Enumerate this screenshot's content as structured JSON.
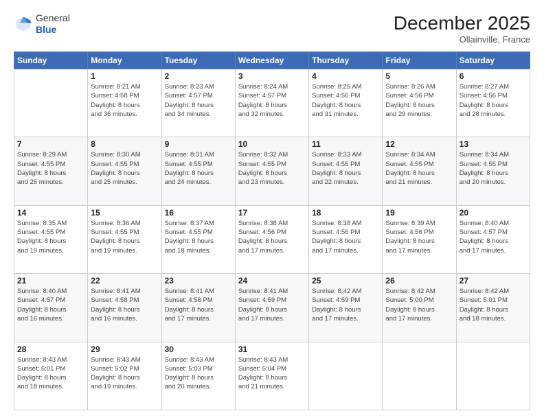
{
  "logo": {
    "general": "General",
    "blue": "Blue"
  },
  "header": {
    "month": "December 2025",
    "location": "Ollainville, France"
  },
  "weekdays": [
    "Sunday",
    "Monday",
    "Tuesday",
    "Wednesday",
    "Thursday",
    "Friday",
    "Saturday"
  ],
  "weeks": [
    [
      {
        "day": "",
        "info": ""
      },
      {
        "day": "1",
        "info": "Sunrise: 8:21 AM\nSunset: 4:58 PM\nDaylight: 8 hours\nand 36 minutes."
      },
      {
        "day": "2",
        "info": "Sunrise: 8:23 AM\nSunset: 4:57 PM\nDaylight: 8 hours\nand 34 minutes."
      },
      {
        "day": "3",
        "info": "Sunrise: 8:24 AM\nSunset: 4:57 PM\nDaylight: 8 hours\nand 32 minutes."
      },
      {
        "day": "4",
        "info": "Sunrise: 8:25 AM\nSunset: 4:56 PM\nDaylight: 8 hours\nand 31 minutes."
      },
      {
        "day": "5",
        "info": "Sunrise: 8:26 AM\nSunset: 4:56 PM\nDaylight: 8 hours\nand 29 minutes."
      },
      {
        "day": "6",
        "info": "Sunrise: 8:27 AM\nSunset: 4:56 PM\nDaylight: 8 hours\nand 28 minutes."
      }
    ],
    [
      {
        "day": "7",
        "info": "Sunrise: 8:29 AM\nSunset: 4:55 PM\nDaylight: 8 hours\nand 26 minutes."
      },
      {
        "day": "8",
        "info": "Sunrise: 8:30 AM\nSunset: 4:55 PM\nDaylight: 8 hours\nand 25 minutes."
      },
      {
        "day": "9",
        "info": "Sunrise: 8:31 AM\nSunset: 4:55 PM\nDaylight: 8 hours\nand 24 minutes."
      },
      {
        "day": "10",
        "info": "Sunrise: 8:32 AM\nSunset: 4:55 PM\nDaylight: 8 hours\nand 23 minutes."
      },
      {
        "day": "11",
        "info": "Sunrise: 8:33 AM\nSunset: 4:55 PM\nDaylight: 8 hours\nand 22 minutes."
      },
      {
        "day": "12",
        "info": "Sunrise: 8:34 AM\nSunset: 4:55 PM\nDaylight: 8 hours\nand 21 minutes."
      },
      {
        "day": "13",
        "info": "Sunrise: 8:34 AM\nSunset: 4:55 PM\nDaylight: 8 hours\nand 20 minutes."
      }
    ],
    [
      {
        "day": "14",
        "info": "Sunrise: 8:35 AM\nSunset: 4:55 PM\nDaylight: 8 hours\nand 19 minutes."
      },
      {
        "day": "15",
        "info": "Sunrise: 8:36 AM\nSunset: 4:55 PM\nDaylight: 8 hours\nand 19 minutes."
      },
      {
        "day": "16",
        "info": "Sunrise: 8:37 AM\nSunset: 4:55 PM\nDaylight: 8 hours\nand 18 minutes."
      },
      {
        "day": "17",
        "info": "Sunrise: 8:38 AM\nSunset: 4:56 PM\nDaylight: 8 hours\nand 17 minutes."
      },
      {
        "day": "18",
        "info": "Sunrise: 8:38 AM\nSunset: 4:56 PM\nDaylight: 8 hours\nand 17 minutes."
      },
      {
        "day": "19",
        "info": "Sunrise: 8:39 AM\nSunset: 4:56 PM\nDaylight: 8 hours\nand 17 minutes."
      },
      {
        "day": "20",
        "info": "Sunrise: 8:40 AM\nSunset: 4:57 PM\nDaylight: 8 hours\nand 17 minutes."
      }
    ],
    [
      {
        "day": "21",
        "info": "Sunrise: 8:40 AM\nSunset: 4:57 PM\nDaylight: 8 hours\nand 16 minutes."
      },
      {
        "day": "22",
        "info": "Sunrise: 8:41 AM\nSunset: 4:58 PM\nDaylight: 8 hours\nand 16 minutes."
      },
      {
        "day": "23",
        "info": "Sunrise: 8:41 AM\nSunset: 4:58 PM\nDaylight: 8 hours\nand 17 minutes."
      },
      {
        "day": "24",
        "info": "Sunrise: 8:41 AM\nSunset: 4:59 PM\nDaylight: 8 hours\nand 17 minutes."
      },
      {
        "day": "25",
        "info": "Sunrise: 8:42 AM\nSunset: 4:59 PM\nDaylight: 8 hours\nand 17 minutes."
      },
      {
        "day": "26",
        "info": "Sunrise: 8:42 AM\nSunset: 5:00 PM\nDaylight: 8 hours\nand 17 minutes."
      },
      {
        "day": "27",
        "info": "Sunrise: 8:42 AM\nSunset: 5:01 PM\nDaylight: 8 hours\nand 18 minutes."
      }
    ],
    [
      {
        "day": "28",
        "info": "Sunrise: 8:43 AM\nSunset: 5:01 PM\nDaylight: 8 hours\nand 18 minutes."
      },
      {
        "day": "29",
        "info": "Sunrise: 8:43 AM\nSunset: 5:02 PM\nDaylight: 8 hours\nand 19 minutes."
      },
      {
        "day": "30",
        "info": "Sunrise: 8:43 AM\nSunset: 5:03 PM\nDaylight: 8 hours\nand 20 minutes."
      },
      {
        "day": "31",
        "info": "Sunrise: 8:43 AM\nSunset: 5:04 PM\nDaylight: 8 hours\nand 21 minutes."
      },
      {
        "day": "",
        "info": ""
      },
      {
        "day": "",
        "info": ""
      },
      {
        "day": "",
        "info": ""
      }
    ]
  ]
}
